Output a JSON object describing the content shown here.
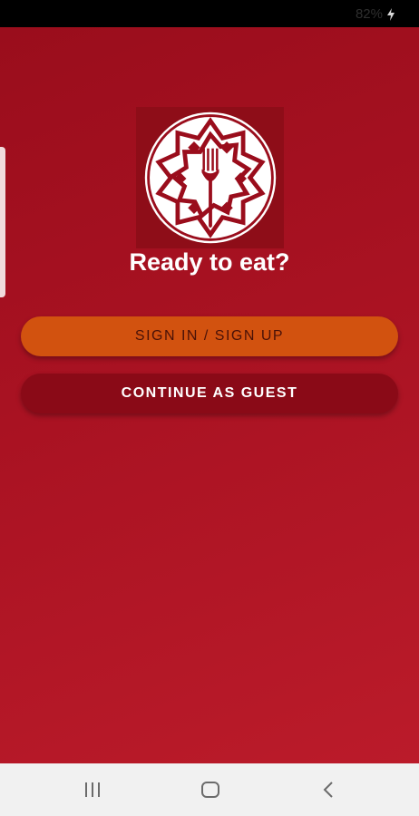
{
  "status_bar": {
    "battery_text": "82%",
    "icons": [
      "charging-bolt-icon"
    ]
  },
  "app": {
    "logo_icon": "mandala-fork-logo",
    "title": "Ready to eat?",
    "buttons": {
      "signin_label": "SIGN IN / SIGN UP",
      "guest_label": "CONTINUE AS GUEST"
    }
  },
  "nav_bar": {
    "icons": [
      "recents-icon",
      "home-icon",
      "back-icon"
    ]
  },
  "colors": {
    "background_top": "#9a0d1c",
    "background_bottom": "#bb1b2a",
    "logo_box": "#8e0d18",
    "signin_button": "#d2520f",
    "signin_text": "#4a1208",
    "guest_button": "#8a0a17",
    "guest_text": "#ffffff",
    "nav_bar": "#f1f1f1"
  }
}
